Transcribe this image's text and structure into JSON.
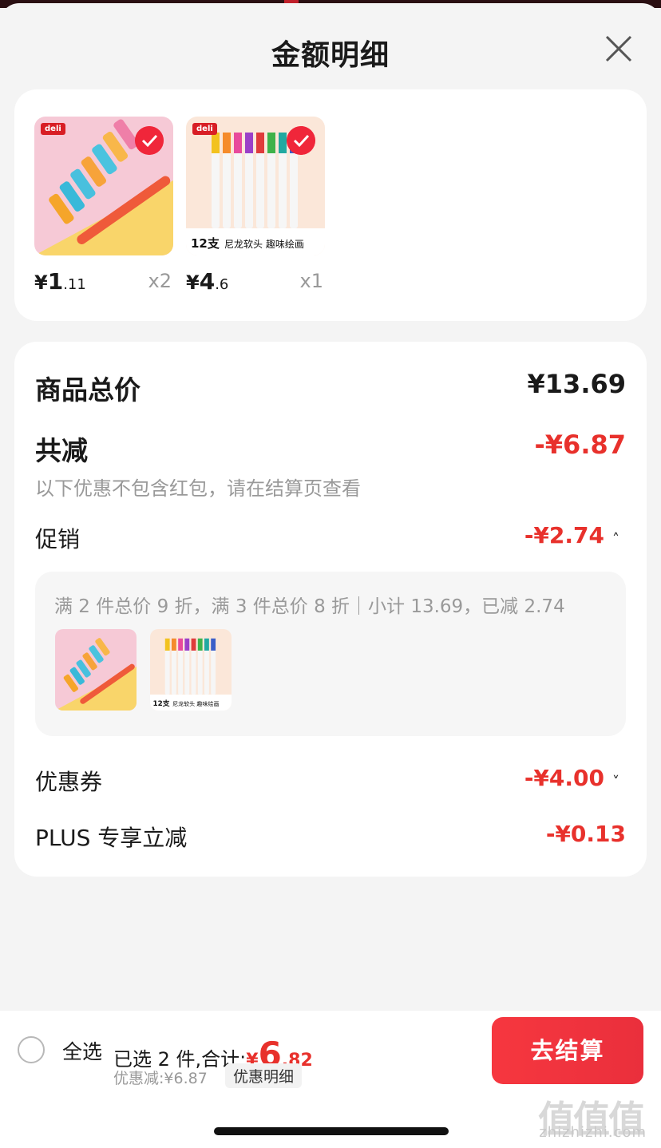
{
  "sheet": {
    "title": "金额明细"
  },
  "products": [
    {
      "price_symbol": "¥",
      "price_int": "1",
      "price_dec": ".11",
      "qty": "x2",
      "brand": "deli",
      "selected": true
    },
    {
      "price_symbol": "¥",
      "price_int": "4",
      "price_dec": ".6",
      "qty": "x1",
      "brand": "deli",
      "selected": true,
      "banner_count": "12支",
      "banner_text": "尼龙软头 趣味绘画"
    }
  ],
  "summary": {
    "total_label": "商品总价",
    "total_value": "¥13.69",
    "discount_label": "共减",
    "discount_value": "-¥6.87",
    "discount_note": "以下优惠不包含红包，请在结算页查看",
    "promo_label": "促销",
    "promo_value": "-¥2.74",
    "promo_detail": "满 2 件总价 9 折，满 3 件总价 8 折｜小计 13.69，已减 2.74",
    "promo_thumb_count": "12支",
    "promo_thumb_text": "尼龙软头 趣味绘画",
    "coupon_label": "优惠券",
    "coupon_value": "-¥4.00",
    "plus_label": "PLUS 专享立减",
    "plus_value": "-¥0.13"
  },
  "bottom": {
    "select_all": "全选",
    "selected_text": "已选 2 件,合计:",
    "total_symbol": "¥",
    "total_int": "6",
    "total_dec": ".82",
    "saved_text": "优惠减:¥6.87",
    "detail_link": "优惠明细",
    "checkout": "去结算"
  },
  "watermark": {
    "logo": "值值值",
    "text": "zhizhizhi.com"
  },
  "colors": {
    "accent": "#e8312c",
    "button": "#f6373f",
    "check": "#f0263a"
  }
}
